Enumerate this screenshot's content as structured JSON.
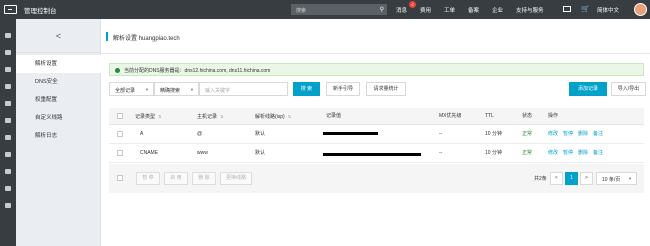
{
  "topbar": {
    "console_label": "管理控制台",
    "search_placeholder": "搜索",
    "message_label": "消息",
    "message_count": "4",
    "nav": [
      "费用",
      "工单",
      "备案",
      "企业",
      "支持与服务"
    ],
    "language": "简体中文"
  },
  "subnav": {
    "back_glyph": "<",
    "items": [
      "解析设置",
      "DNS安全",
      "权重配置",
      "自定义线路",
      "解析日志"
    ]
  },
  "main": {
    "title": "解析设置 huangpiao.tech",
    "notice": "当前分配的DNS服务器是：dns12.hichina.com, dns11.hichina.com"
  },
  "filters": {
    "record_type": "全部记录",
    "search_mode": "精确搜索",
    "keyword_placeholder": "输入关键字",
    "search_button": "搜 索",
    "guide_button": "新手引导",
    "stats_button": "请求量统计",
    "add_button": "添加记录",
    "import_button": "导入/导出"
  },
  "table": {
    "headers": [
      "记录类型",
      "主机记录",
      "解析线路(isp)",
      "记录值",
      "MX优先级",
      "TTL",
      "状态",
      "操作"
    ],
    "rows": [
      {
        "type": "A",
        "host": "@",
        "line": "默认",
        "mx": "--",
        "ttl": "10 分钟",
        "status": "正常",
        "ops": [
          "修改",
          "暂停",
          "删除",
          "备注"
        ]
      },
      {
        "type": "CNAME",
        "host": "www",
        "line": "默认",
        "mx": "--",
        "ttl": "10 分钟",
        "status": "正常",
        "ops": [
          "修改",
          "暂停",
          "删除",
          "备注"
        ]
      }
    ]
  },
  "footer": {
    "bulk_buttons": [
      "暂 停",
      "启 用",
      "删 除",
      "更换线路"
    ],
    "total": "共2条",
    "prev": "<",
    "current_page": "1",
    "next": ">",
    "page_size": "10 条/页"
  }
}
